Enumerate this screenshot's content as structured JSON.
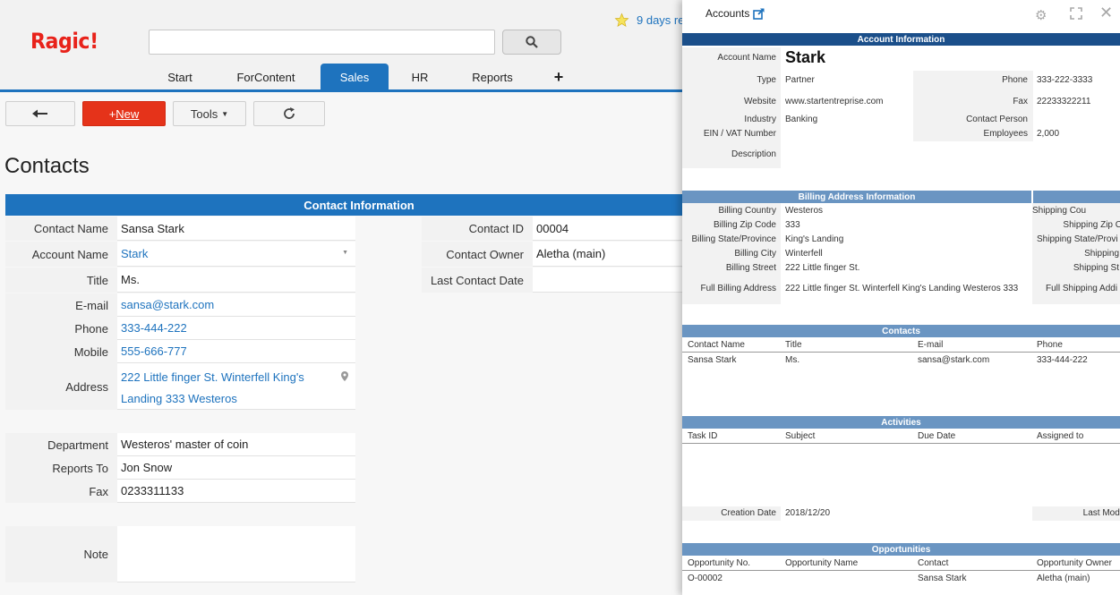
{
  "app": {
    "logo": "Ragic!",
    "trial_text": "9 days re"
  },
  "nav": {
    "tabs": [
      {
        "label": "Start"
      },
      {
        "label": "ForContent"
      },
      {
        "label": "Sales"
      },
      {
        "label": "HR"
      },
      {
        "label": "Reports"
      },
      {
        "label": "+"
      }
    ],
    "active": "Sales"
  },
  "toolbar": {
    "new_label": "New",
    "new_prefix": "+",
    "tools_label": "Tools"
  },
  "page": {
    "title": "Contacts",
    "section": "Contact Information"
  },
  "contact": {
    "left": [
      {
        "label": "Contact Name",
        "value": "Sansa Stark"
      },
      {
        "label": "Account Name",
        "value": "Stark"
      },
      {
        "label": "Title",
        "value": "Ms."
      },
      {
        "label": "E-mail",
        "value": "sansa@stark.com"
      },
      {
        "label": "Phone",
        "value": "333-444-222"
      },
      {
        "label": "Mobile",
        "value": "555-666-777"
      },
      {
        "label": "Address",
        "value": "222 Little finger St. Winterfell King's Landing 333 Westeros",
        "line1": "222 Little finger St. Winterfell King's",
        "line2": "Landing 333 Westeros"
      },
      {
        "label": "Department",
        "value": "Westeros' master of coin"
      },
      {
        "label": "Reports To",
        "value": "Jon Snow"
      },
      {
        "label": "Fax",
        "value": "0233311133"
      },
      {
        "label": "Note",
        "value": ""
      }
    ],
    "right": [
      {
        "label": "Contact ID",
        "value": "00004"
      },
      {
        "label": "Contact Owner",
        "value": "Aletha (main)"
      },
      {
        "label": "Last Contact Date",
        "value": ""
      }
    ]
  },
  "panel": {
    "title": "Accounts",
    "account_info": {
      "header": "Account Information",
      "account_name_label": "Account Name",
      "account_name": "Stark",
      "type_label": "Type",
      "type": "Partner",
      "website_label": "Website",
      "website": "www.startentreprise.com",
      "industry_label": "Industry",
      "industry": "Banking",
      "ein_label": "EIN / VAT Number",
      "ein": "",
      "description_label": "Description",
      "phone_label": "Phone",
      "phone": "333-222-3333",
      "fax_label": "Fax",
      "fax": "22233322211",
      "contact_person_label": "Contact Person",
      "contact_person": "",
      "employees_label": "Employees",
      "employees": "2,000"
    },
    "billing": {
      "header": "Billing Address Information",
      "rows": [
        {
          "label": "Billing Country",
          "value": "Westeros"
        },
        {
          "label": "Billing Zip Code",
          "value": "333"
        },
        {
          "label": "Billing State/Province",
          "value": "King's Landing"
        },
        {
          "label": "Billing City",
          "value": "Winterfell"
        },
        {
          "label": "Billing Street",
          "value": "222 Little finger St."
        }
      ],
      "full_label": "Full Billing Address",
      "full_value": "222 Little finger St. Winterfell King's Landing Westeros 333",
      "shipping": [
        "Shipping Cou",
        "Shipping Zip C",
        "Shipping State/Provi",
        "Shipping",
        "Shipping St"
      ],
      "full_shipping": "Full Shipping Addi"
    },
    "contacts": {
      "header": "Contacts",
      "columns": [
        "Contact Name",
        "Title",
        "E-mail",
        "Phone"
      ],
      "rows": [
        {
          "name": "Sansa Stark",
          "title": "Ms.",
          "email": "sansa@stark.com",
          "phone": "333-444-222"
        }
      ]
    },
    "activities": {
      "header": "Activities",
      "columns": [
        "Task ID",
        "Subject",
        "Due Date",
        "Assigned to"
      ]
    },
    "creation": {
      "label": "Creation Date",
      "value": "2018/12/20",
      "last_mod": "Last Modi"
    },
    "opportunities": {
      "header": "Opportunities",
      "columns": [
        "Opportunity No.",
        "Opportunity Name",
        "Contact",
        "Opportunity Owner"
      ],
      "rows": [
        {
          "no": "O-00002",
          "name": "",
          "contact": "Sansa Stark",
          "owner": "Aletha (main)"
        }
      ]
    }
  }
}
